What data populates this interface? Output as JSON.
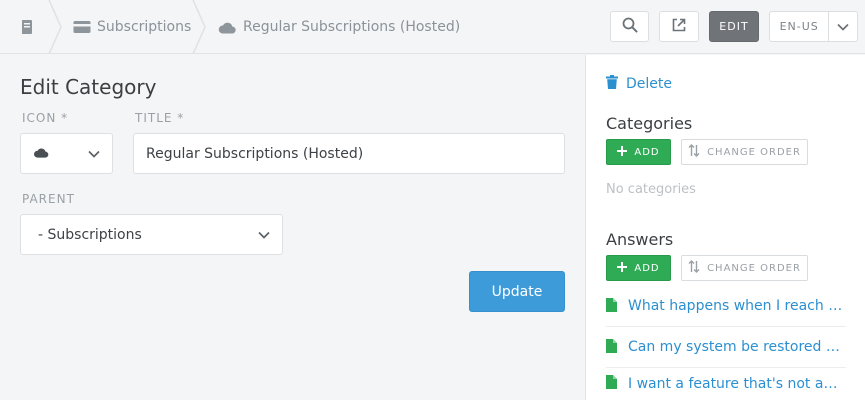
{
  "breadcrumb": {
    "root_icon": "book-icon",
    "items": [
      {
        "icon": "card-icon",
        "label": "Subscriptions"
      },
      {
        "icon": "cloud-icon",
        "label": "Regular Subscriptions (Hosted)"
      }
    ]
  },
  "header": {
    "search_icon": "search-icon",
    "open_icon": "external-link-icon",
    "edit_label": "EDIT",
    "language": "EN-US",
    "language_icon": "chevron-down-icon"
  },
  "form": {
    "title": "Edit Category",
    "icon_label": "ICON *",
    "icon_value": "cloud-icon",
    "title_label": "TITLE *",
    "title_value": "Regular Subscriptions (Hosted)",
    "parent_label": "PARENT",
    "parent_value": "- Subscriptions",
    "update_label": "Update"
  },
  "sidebar": {
    "delete_label": "Delete",
    "categories": {
      "heading": "Categories",
      "add_label": "ADD",
      "order_label": "CHANGE ORDER",
      "empty_text": "No categories"
    },
    "answers": {
      "heading": "Answers",
      "add_label": "ADD",
      "order_label": "CHANGE ORDER",
      "items": [
        "What happens when I reach my ...",
        "Can my system be restored to a...",
        "I want a feature that's not avail..."
      ]
    }
  },
  "colors": {
    "accent_blue": "#3d9bd9",
    "link_blue": "#2b8fd0",
    "add_green": "#2fab56",
    "edit_gray": "#707478"
  }
}
